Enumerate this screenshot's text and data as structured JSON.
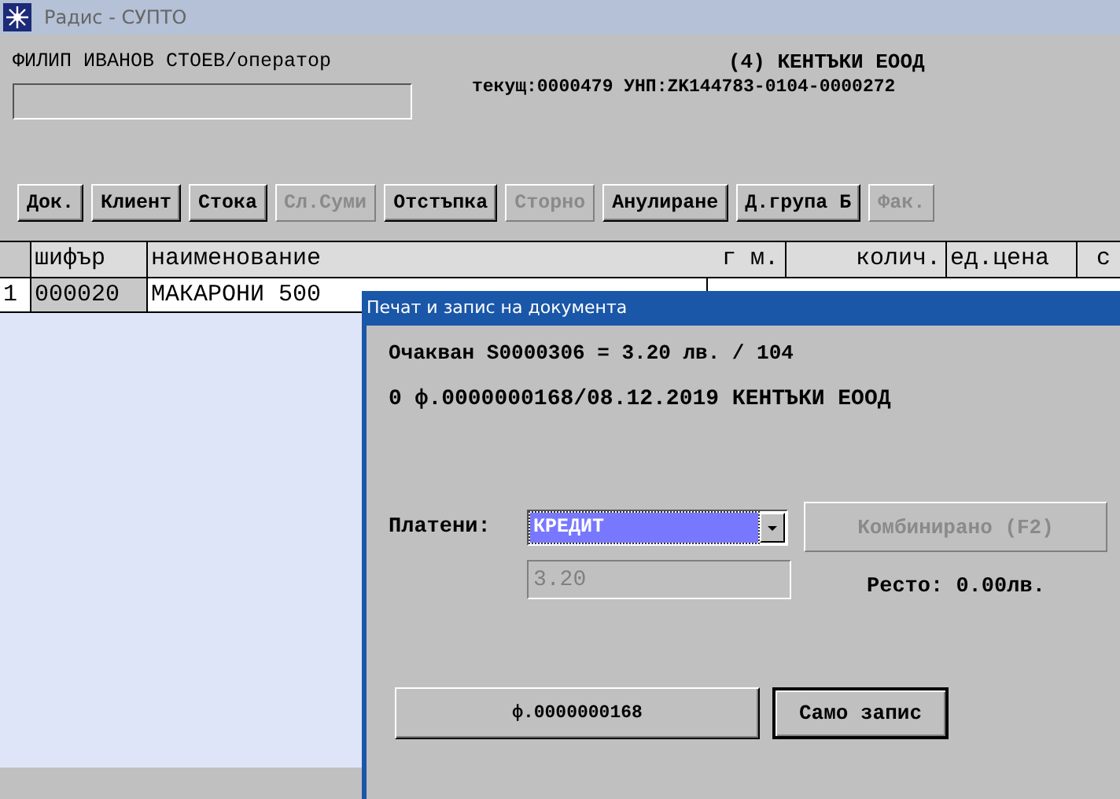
{
  "window": {
    "title": "Радис - СУПТО"
  },
  "header": {
    "operator": "ФИЛИП ИВАНОВ СТОЕВ/оператор",
    "company": "(4) КЕНТЪКИ ЕООД",
    "info": "текущ:0000479 УНП:ZK144783-0104-0000272"
  },
  "toolbar": [
    {
      "label": "Док.",
      "disabled": false
    },
    {
      "label": "Клиент",
      "disabled": false
    },
    {
      "label": "Стока",
      "disabled": false
    },
    {
      "label": "Сл.Суми",
      "disabled": true
    },
    {
      "label": "Отстъпка",
      "disabled": false
    },
    {
      "label": "Сторно",
      "disabled": true
    },
    {
      "label": "Анулиране",
      "disabled": false
    },
    {
      "label": "Д.група Б",
      "disabled": false
    },
    {
      "label": "Фак.",
      "disabled": true
    }
  ],
  "table": {
    "columns": [
      "шифър",
      "наименование",
      "г м.",
      "колич.",
      "ед.цена",
      "с"
    ],
    "rows": [
      {
        "number": "1",
        "code": "000020",
        "name": "МАКАРОНИ 500"
      }
    ]
  },
  "dialog": {
    "title": "Печат и запис на документа",
    "line_1": "Очакван S0000306  = 3.20 лв. / 104",
    "line_2": "0 ф.0000000168/08.12.2019 КЕНТЪКИ ЕООД",
    "payment_label": "Платени:",
    "payment_value": "КРЕДИТ",
    "combined_button": {
      "label": "Комбинирано (F2)",
      "disabled": true
    },
    "amount": {
      "value": "3.20",
      "disabled": true
    },
    "change": "Ресто: 0.00лв.",
    "buttons": [
      {
        "label": "ф.0000000168",
        "focused": false
      },
      {
        "label": "Само запис",
        "focused": true
      }
    ]
  }
}
